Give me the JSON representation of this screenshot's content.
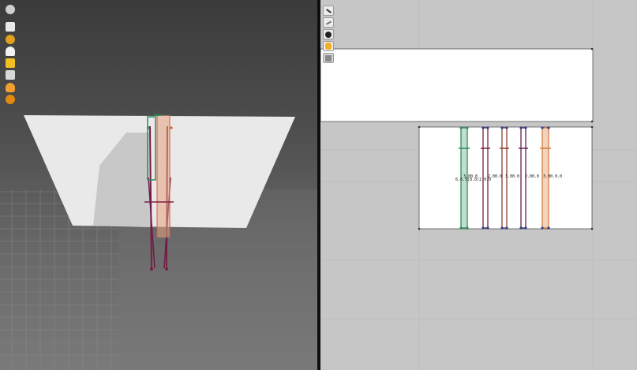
{
  "left_toolbar": {
    "tools": [
      {
        "icon": "view-cube-icon",
        "color": "#cfcfcf"
      },
      {
        "icon": "shirt-icon",
        "color": "#e8e8e8"
      },
      {
        "icon": "rotate-icon",
        "color": "#e0a020"
      },
      {
        "icon": "avatar-icon",
        "color": "#f2f2f2"
      },
      {
        "icon": "folder-icon",
        "color": "#f0c020"
      },
      {
        "icon": "brush-icon",
        "color": "#d8d8d8"
      },
      {
        "icon": "person-icon",
        "color": "#f0a030"
      },
      {
        "icon": "gear-icon",
        "color": "#e08a10"
      }
    ]
  },
  "right_toolbar": {
    "tools": [
      {
        "icon": "select-arrow-icon",
        "color": "#333333"
      },
      {
        "icon": "transform-icon",
        "color": "#777777"
      },
      {
        "icon": "info-icon",
        "color": "#222222"
      },
      {
        "icon": "hand-icon",
        "color": "#f0b020"
      },
      {
        "icon": "layers-icon",
        "color": "#888888"
      }
    ]
  },
  "pattern": {
    "dimension_labels": [
      "6.6.5|8.0/2.0.0",
      "3.00.0",
      "2.00.0",
      "3.00.0",
      "2.00.0",
      "3.00.0.0"
    ],
    "strap_colors": [
      "#2f8a5a",
      "#7a2040",
      "#8a4030",
      "#6a1a50",
      "#d27a40"
    ]
  },
  "accents": {
    "left_bg": "#555555",
    "right_bg": "#c6c6c6",
    "panel": "#ffffff"
  }
}
